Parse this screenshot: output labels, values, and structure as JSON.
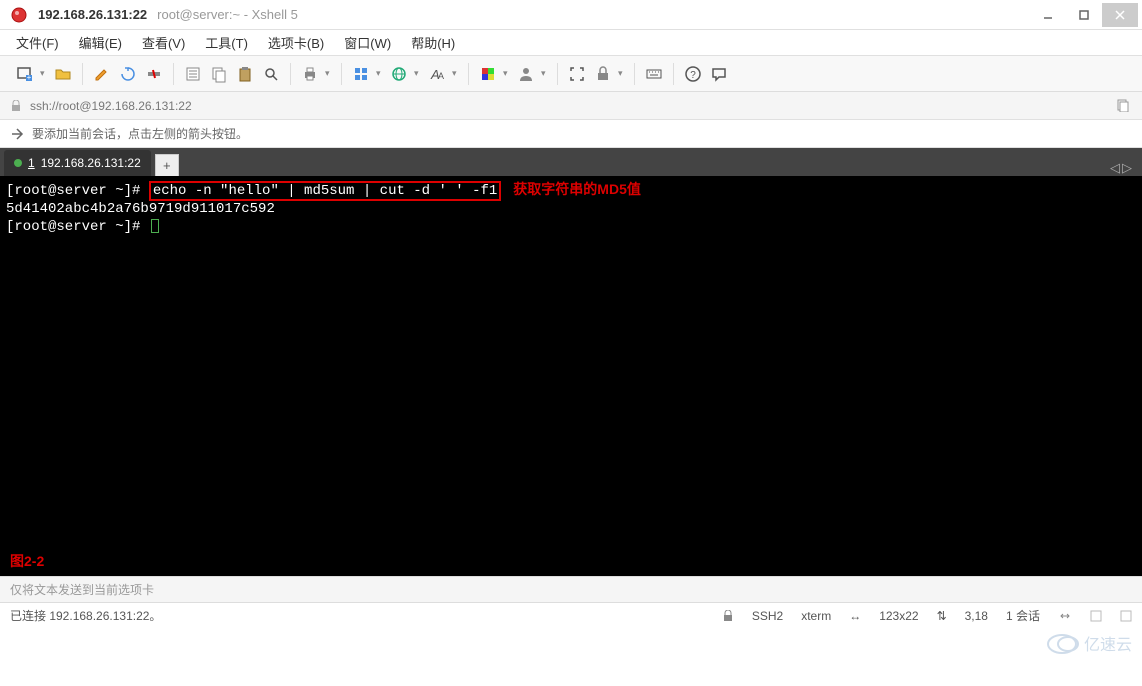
{
  "window": {
    "title": "192.168.26.131:22",
    "subtitle": "root@server:~ - Xshell 5"
  },
  "menu": {
    "file": "文件(F)",
    "edit": "编辑(E)",
    "view": "查看(V)",
    "tools": "工具(T)",
    "tabs": "选项卡(B)",
    "window": "窗口(W)",
    "help": "帮助(H)"
  },
  "address": {
    "url": "ssh://root@192.168.26.131:22"
  },
  "hint": {
    "text": "要添加当前会话，点击左侧的箭头按钮。"
  },
  "tab": {
    "index": "1",
    "label": "192.168.26.131:22",
    "newtab": "+"
  },
  "terminal": {
    "prompt1": "[root@server ~]# ",
    "cmd1": "echo -n \"hello\" | md5sum | cut -d ' ' -f1",
    "comment1": "获取字符串的MD5值",
    "output1": "5d41402abc4b2a76b9719d911017c592",
    "prompt2": "[root@server ~]# ",
    "figure": "图2-2"
  },
  "sendhint": "仅将文本发送到当前选项卡",
  "status": {
    "connected": "已连接 192.168.26.131:22。",
    "protocol": "SSH2",
    "term": "xterm",
    "size": "123x22",
    "pos": "3,18",
    "sessions": "1 会话",
    "resize": "↔"
  },
  "watermark": "亿速云",
  "icons": {
    "dd": "▾",
    "left": "◁",
    "right": "▷",
    "sizearrow": "↔",
    "posarrow": "⇅"
  }
}
